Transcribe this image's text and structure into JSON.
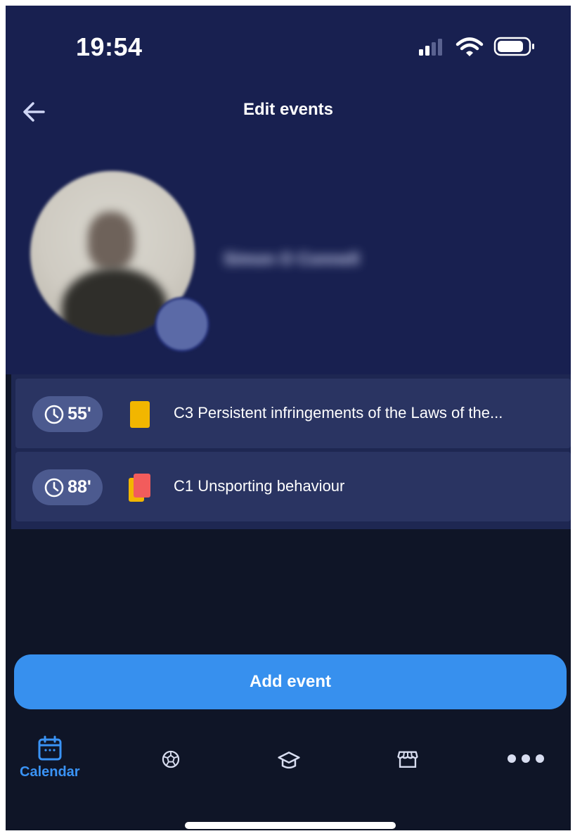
{
  "status_bar": {
    "time": "19:54",
    "icons": [
      "cellular-signal-icon",
      "wifi-icon",
      "battery-icon"
    ]
  },
  "header": {
    "title": "Edit events",
    "back_icon": "back-arrow-icon"
  },
  "profile": {
    "name": "Simon O Connell",
    "avatar_badge_icon": "edit-icon"
  },
  "events": [
    {
      "minute": "55'",
      "card": "yellow-card-icon",
      "description": "C3 Persistent infringements of the Laws of the..."
    },
    {
      "minute": "88'",
      "card": "second-yellow-red-card-icon",
      "description": "C1 Unsporting behaviour"
    }
  ],
  "add_button": {
    "label": "Add event"
  },
  "tab_bar": {
    "tabs": [
      {
        "label": "Calendar",
        "icon": "calendar-icon",
        "active": true
      },
      {
        "label": "",
        "icon": "football-icon"
      },
      {
        "label": "",
        "icon": "graduation-cap-icon"
      },
      {
        "label": "",
        "icon": "store-icon"
      },
      {
        "label": "",
        "icon": "more-icon"
      }
    ]
  },
  "colors": {
    "accent": "#3790ee",
    "header_bg": "#182050",
    "background": "#0f1527",
    "event_bg": "#2a3462",
    "yellow_card": "#f2b600",
    "red_card": "#f25c5c"
  }
}
